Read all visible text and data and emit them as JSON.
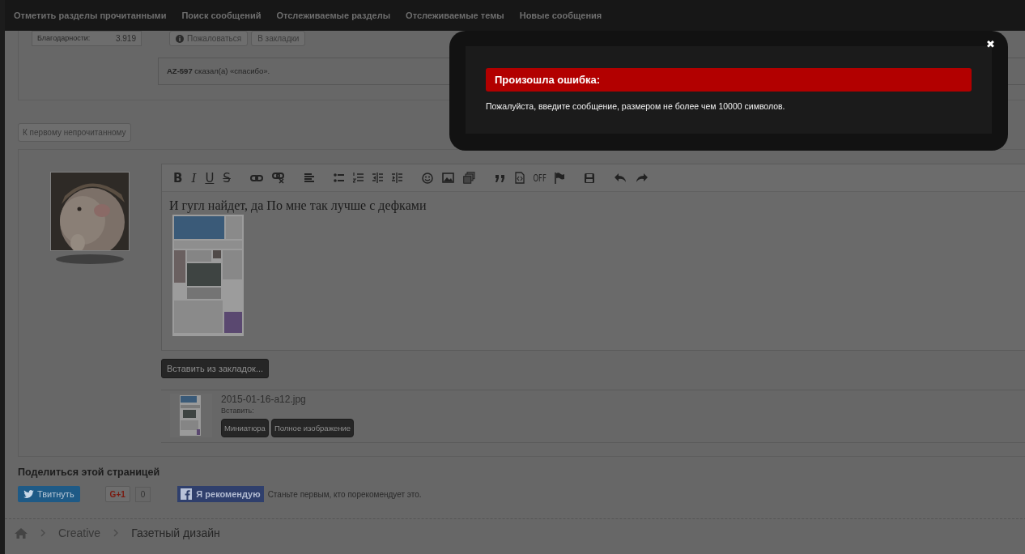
{
  "nav": {
    "links": [
      "Отметить разделы прочитанными",
      "Поиск сообщений",
      "Отслеживаемые разделы",
      "Отслеживаемые темы",
      "Новые сообщения"
    ]
  },
  "post_summary": {
    "thanks_label": "Благодарности:",
    "thanks_value": "3.919",
    "actions": [
      "Пожаловаться",
      "В закладки"
    ],
    "likes_text": "**AZ-597** сказал(а) «спасибо»."
  },
  "jump_button": "К первому непрочитанному",
  "editor": {
    "toolbar_text": [
      "B",
      "I",
      "U",
      "S",
      "OFF"
    ],
    "message": "И гугл найдет, да По мне так лучше с дефками",
    "bookmarks_button": "Вставить из закладок..."
  },
  "attachment": {
    "filename": "2015-01-16-a12.jpg",
    "insert_label": "Вставить:",
    "buttons": [
      "Миниатюра",
      "Полное изображение"
    ]
  },
  "share": {
    "title": "Поделиться этой страницей",
    "tweet": "Твитнуть",
    "gplus": "G+1",
    "gplus_count": "0",
    "facebook": "Я рекомендую",
    "facebook_note": "Станьте первым, кто порекомендует это."
  },
  "breadcrumb": [
    "Creative",
    "Газетный дизайн"
  ],
  "modal": {
    "title": "Произошла ошибка:",
    "message": "Пожалуйста, введите сообщение, размером не более чем 10000 символов.",
    "close": "✖"
  }
}
